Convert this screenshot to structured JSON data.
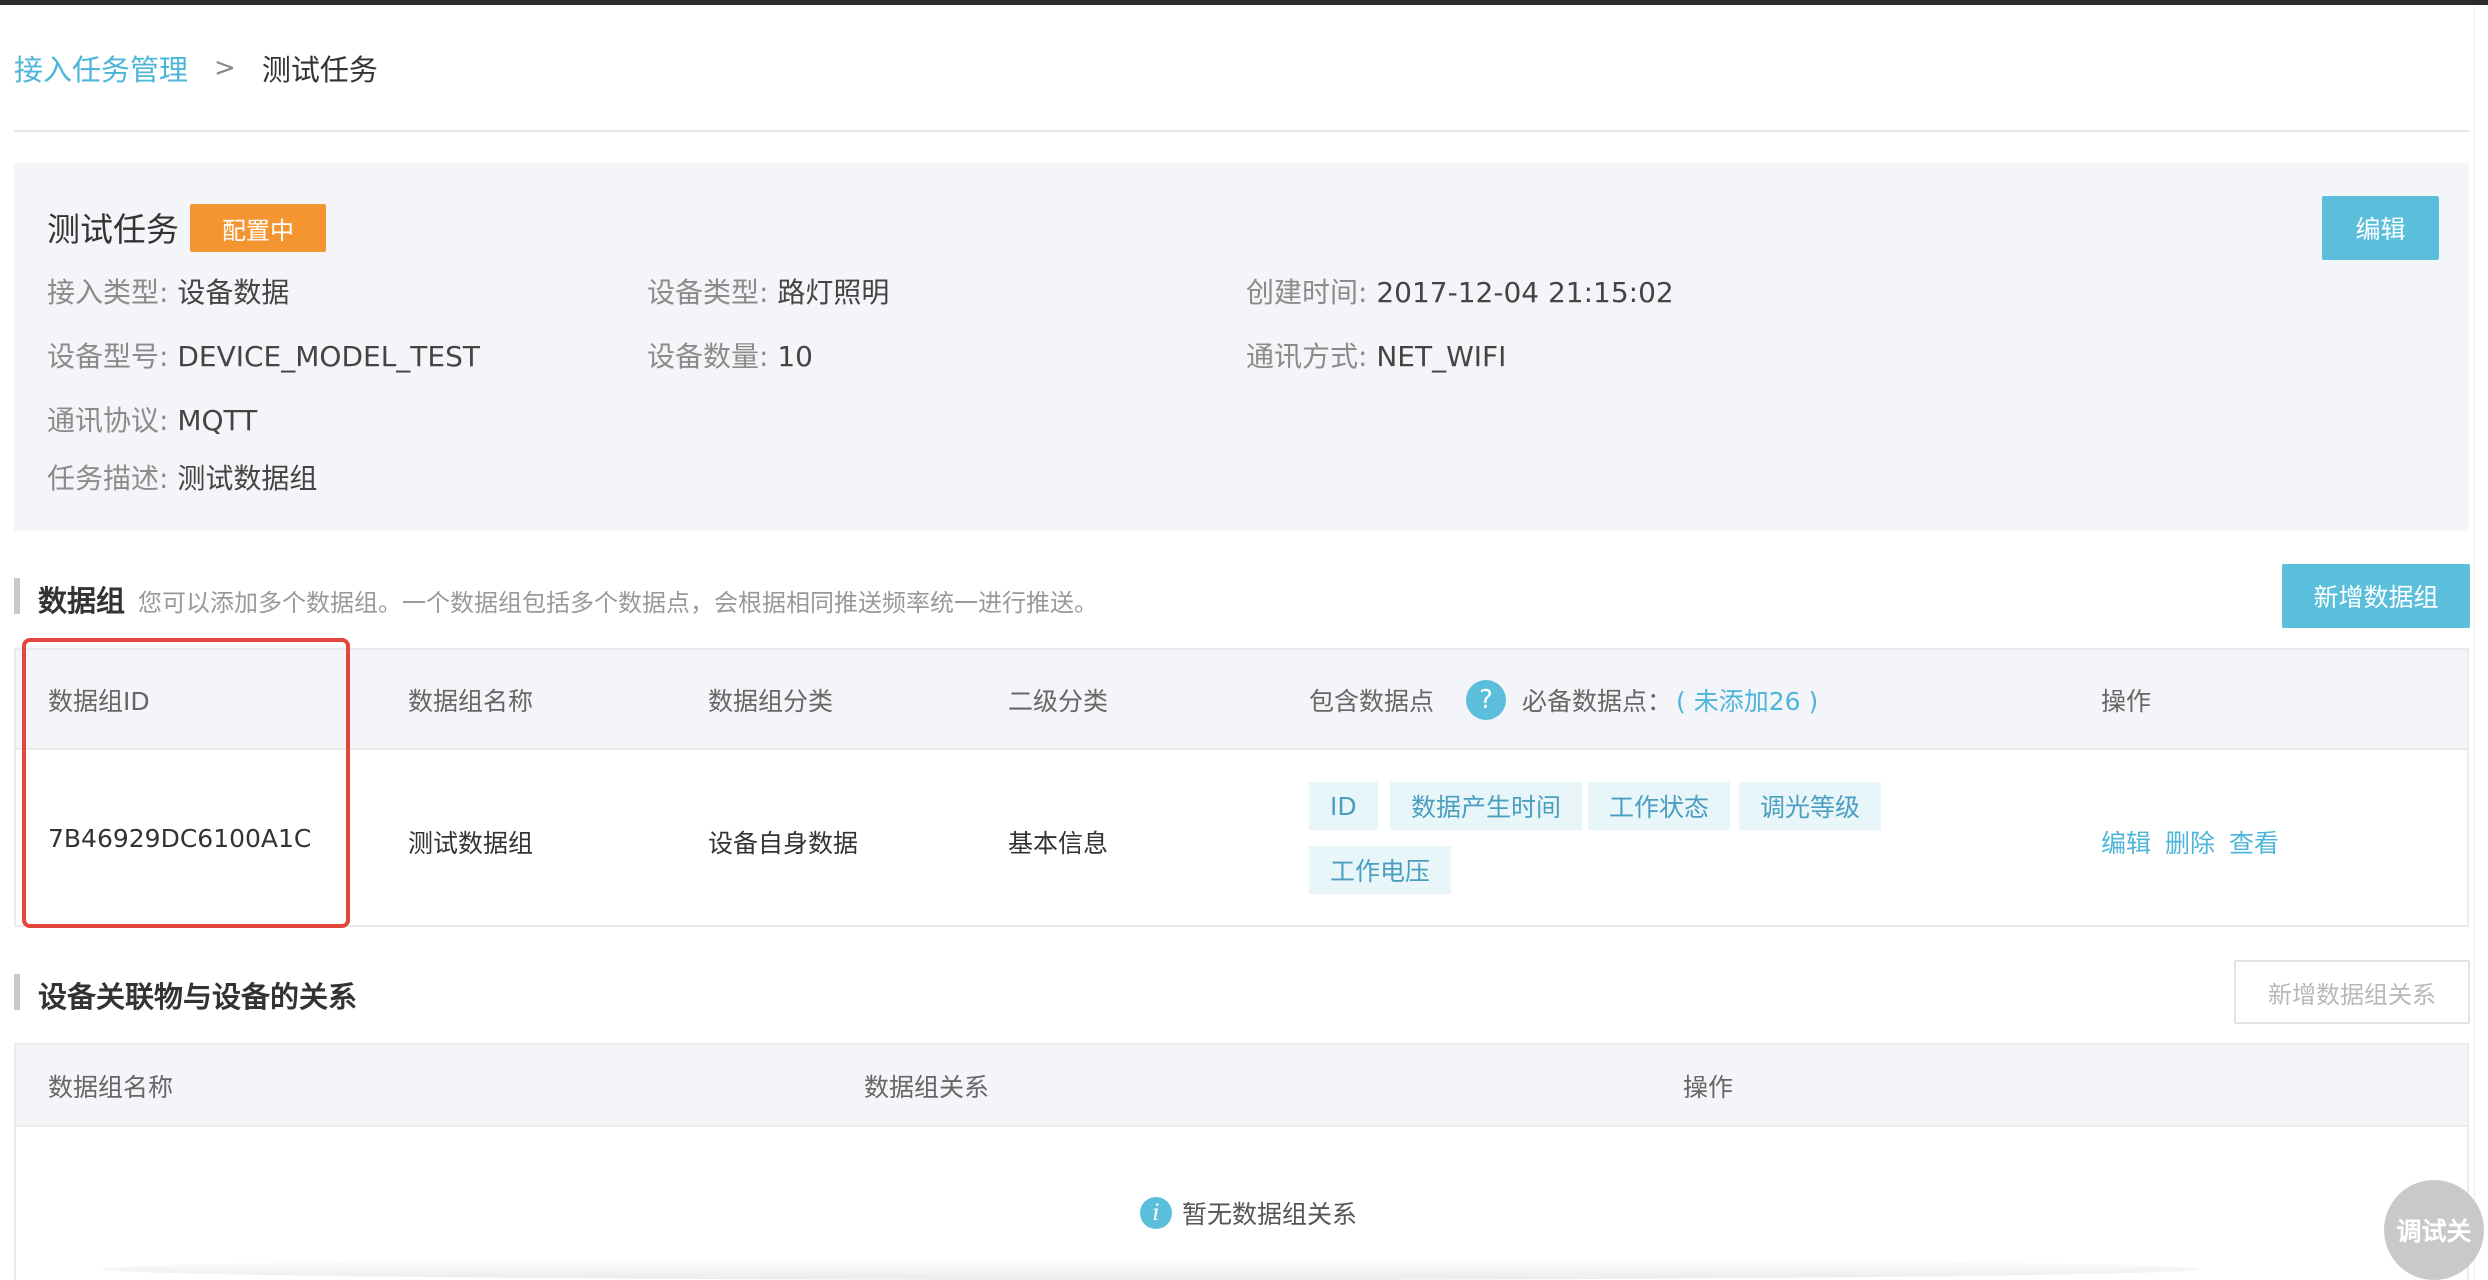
{
  "breadcrumb": {
    "parent": "接入任务管理",
    "separator": ">",
    "current": "测试任务"
  },
  "task": {
    "title": "测试任务",
    "status": "配置中",
    "status_color": "#f59531",
    "edit_label": "编辑",
    "fields": {
      "access_type": {
        "label": "接入类型:",
        "value": "设备数据"
      },
      "device_type": {
        "label": "设备类型:",
        "value": "路灯照明"
      },
      "created_time": {
        "label": "创建时间:",
        "value": "2017-12-04 21:15:02"
      },
      "device_model": {
        "label": "设备型号:",
        "value": "DEVICE_MODEL_TEST"
      },
      "device_count": {
        "label": "设备数量:",
        "value": "10"
      },
      "comm_method": {
        "label": "通讯方式:",
        "value": "NET_WIFI"
      },
      "comm_protocol": {
        "label": "通讯协议:",
        "value": "MQTT"
      },
      "description": {
        "label": "任务描述:",
        "value": "测试数据组"
      }
    }
  },
  "data_groups": {
    "title": "数据组",
    "description": "您可以添加多个数据组。一个数据组包括多个数据点，会根据相同推送频率统一进行推送。",
    "add_label": "新增数据组",
    "columns": {
      "id": "数据组ID",
      "name": "数据组名称",
      "category": "数据组分类",
      "subcategory": "二级分类",
      "points": "包含数据点",
      "help_icon": "?",
      "required_label": "必备数据点：",
      "required_hint": "( 未添加26 )",
      "actions": "操作"
    },
    "rows": [
      {
        "id": "7B46929DC6100A1C",
        "name": "测试数据组",
        "category": "设备自身数据",
        "subcategory": "基本信息",
        "points": [
          "ID",
          "数据产生时间",
          "工作状态",
          "调光等级",
          "工作电压"
        ],
        "actions": [
          "编辑",
          "删除",
          "查看"
        ]
      }
    ]
  },
  "relations": {
    "title": "设备关联物与设备的关系",
    "add_label": "新增数据组关系",
    "columns": {
      "name": "数据组名称",
      "relation": "数据组关系",
      "actions": "操作"
    },
    "empty_icon": "i",
    "empty_text": "暂无数据组关系"
  },
  "debug_button": "调试关",
  "colors": {
    "accent": "#5bbfdc",
    "link": "#4db5d8",
    "highlight": "#e2463f",
    "panel_bg": "#f4f5f8"
  }
}
